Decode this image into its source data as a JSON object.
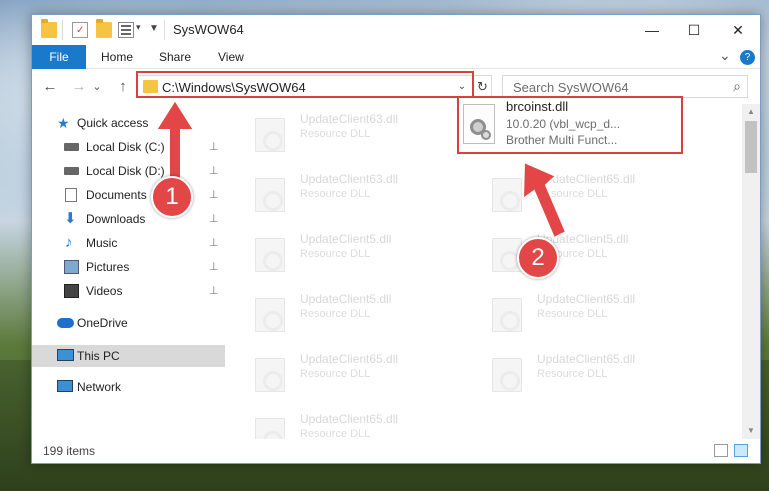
{
  "window": {
    "title": "SysWOW64",
    "minimize_icon": "minimize-icon",
    "maximize_icon": "maximize-icon",
    "close_icon": "close-icon",
    "minimize_glyph": "—",
    "maximize_glyph": "☐",
    "close_glyph": "✕"
  },
  "ribbon": {
    "tabs": [
      "File",
      "Home",
      "Share",
      "View"
    ],
    "expand_glyph": "⌄",
    "help_glyph": "?"
  },
  "nav": {
    "back_glyph": "←",
    "forward_glyph": "→",
    "recent_glyph": "⌄",
    "up_glyph": "↑",
    "address": "C:\\Windows\\SysWOW64",
    "address_dropdown_glyph": "⌄",
    "refresh_glyph": "↻",
    "search_placeholder": "Search SysWOW64",
    "search_glyph": "⌕"
  },
  "sidebar": {
    "quick_access": "Quick access",
    "items": [
      {
        "label": "Local Disk (C:)",
        "pinned": true
      },
      {
        "label": "Local Disk (D:)",
        "pinned": true
      },
      {
        "label": "Documents",
        "pinned": true
      },
      {
        "label": "Downloads",
        "pinned": true
      },
      {
        "label": "Music",
        "pinned": true
      },
      {
        "label": "Pictures",
        "pinned": true
      },
      {
        "label": "Videos",
        "pinned": true
      }
    ],
    "pin_glyph": "📌",
    "onedrive": "OneDrive",
    "this_pc": "This PC",
    "network": "Network"
  },
  "files": {
    "left_column": [
      {
        "name": "UpdateClient63.dll",
        "type": "Resource DLL"
      },
      {
        "name": "UpdateClient63.dll",
        "type": "Resource DLL"
      },
      {
        "name": "UpdateClient5.dll",
        "type": "Resource DLL"
      },
      {
        "name": "UpdateClient5.dll",
        "type": "Resource DLL"
      },
      {
        "name": "UpdateClient65.dll",
        "type": "Resource DLL"
      },
      {
        "name": "UpdateClient65.dll",
        "type": "Resource DLL"
      }
    ],
    "right_column": [
      {
        "name": "UpdateClient65.dll",
        "type": "Resource DLL"
      },
      {
        "name": "UpdateClient5.dll",
        "type": "Resource DLL"
      },
      {
        "name": "UpdateClient65.dll",
        "type": "Resource DLL"
      },
      {
        "name": "UpdateClient65.dll",
        "type": "Resource DLL"
      }
    ],
    "highlighted": {
      "name": "brcoinst.dll",
      "version": "10.0.20 (vbl_wcp_d...",
      "description": "Brother Multi Funct..."
    }
  },
  "scroll": {
    "up_glyph": "▲",
    "down_glyph": "▼"
  },
  "status": {
    "item_count": "199 items"
  },
  "callouts": [
    {
      "number": "1"
    },
    {
      "number": "2"
    }
  ],
  "colors": {
    "accent": "#1979ca",
    "callout": "#e24646"
  }
}
